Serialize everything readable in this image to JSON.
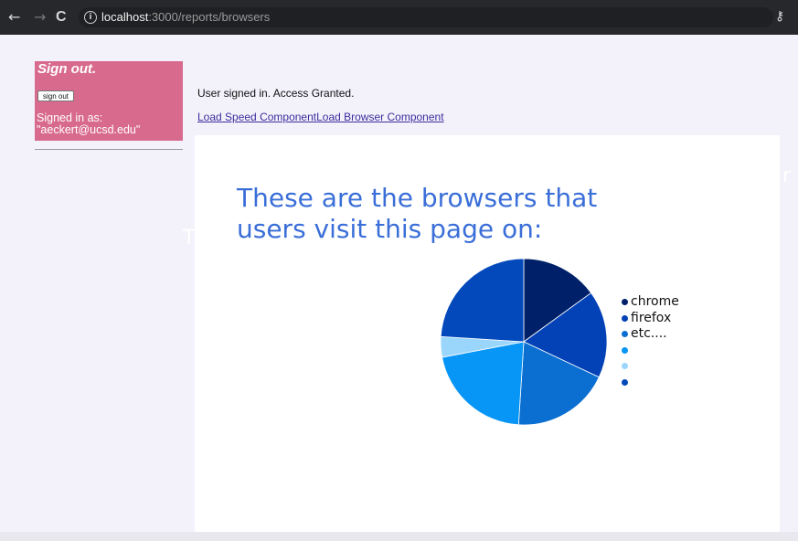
{
  "browser": {
    "url_host": "localhost",
    "url_path": ":3000/reports/browsers",
    "back_glyph": "←",
    "forward_glyph": "→",
    "reload_glyph": "C",
    "info_glyph": "i",
    "key_glyph": "⚷"
  },
  "sidebar": {
    "title": "Sign out.",
    "signout_button": "sign out",
    "signed_in_label": "Signed in as:",
    "signed_in_email": "\"aeckert@ucsd.edu\""
  },
  "main": {
    "status": "User signed in. Access Granted.",
    "links": [
      {
        "label": "Load Speed Component"
      },
      {
        "label": "Load Browser Component"
      }
    ]
  },
  "report": {
    "ghost_left": "T",
    "ghost_right": "r"
  },
  "chart_data": {
    "type": "pie",
    "title": "These are the browsers that users visit this page on:",
    "slices": [
      {
        "label": "chrome",
        "value": 15,
        "color": "#002169"
      },
      {
        "label": "firefox",
        "value": 17,
        "color": "#0342b6"
      },
      {
        "label": "etc....",
        "value": 19,
        "color": "#0b6fd2"
      },
      {
        "label": "",
        "value": 21,
        "color": "#0795f6"
      },
      {
        "label": "",
        "value": 4,
        "color": "#9ad6fb"
      },
      {
        "label": "",
        "value": 24,
        "color": "#0349bb"
      }
    ]
  }
}
